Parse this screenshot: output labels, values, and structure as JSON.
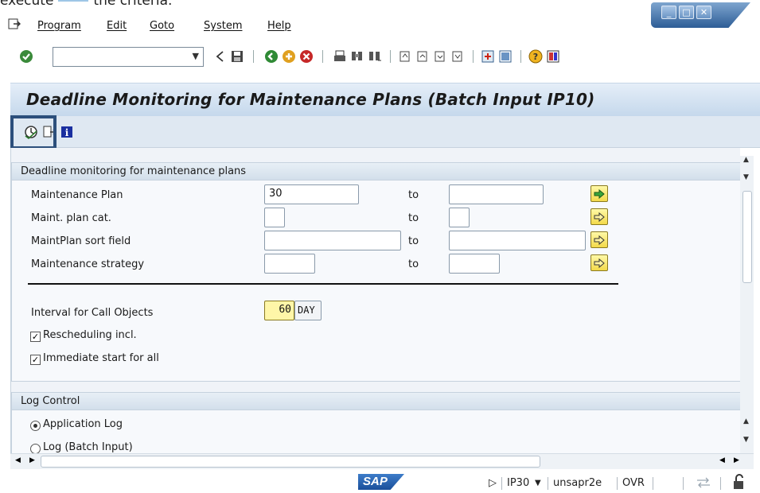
{
  "top_text": {
    "prefix": "execute",
    "suffix": "the criteria."
  },
  "menu": {
    "items": [
      "Program",
      "Edit",
      "Goto",
      "System",
      "Help"
    ]
  },
  "toolbar": {
    "command_value": ""
  },
  "title": "Deadline Monitoring for Maintenance Plans (Batch Input IP10)",
  "selection": {
    "heading": "Deadline monitoring for maintenance plans",
    "to_label": "to",
    "rows": [
      {
        "label": "Maintenance Plan",
        "from": "30",
        "to": ""
      },
      {
        "label": "Maint. plan cat.",
        "from": "",
        "to": ""
      },
      {
        "label": "MaintPlan sort field",
        "from": "",
        "to": ""
      },
      {
        "label": "Maintenance strategy",
        "from": "",
        "to": ""
      }
    ],
    "interval_label": "Interval for Call Objects",
    "interval_value": "60",
    "interval_unit": "DAY",
    "rescheduling_label": "Rescheduling incl.",
    "rescheduling_checked": true,
    "immediate_label": "Immediate start for all",
    "immediate_checked": true
  },
  "log_control": {
    "heading": "Log Control",
    "options": [
      "Application Log",
      "Log (Batch Input)"
    ],
    "selected": "Application Log"
  },
  "status": {
    "brand": "SAP",
    "transaction": "IP30",
    "server": "unsapr2e",
    "mode": "OVR"
  },
  "colors": {
    "accent": "#2c4f7c",
    "title_band": "#c5d8ec",
    "multiselect": "#f3d94a"
  }
}
